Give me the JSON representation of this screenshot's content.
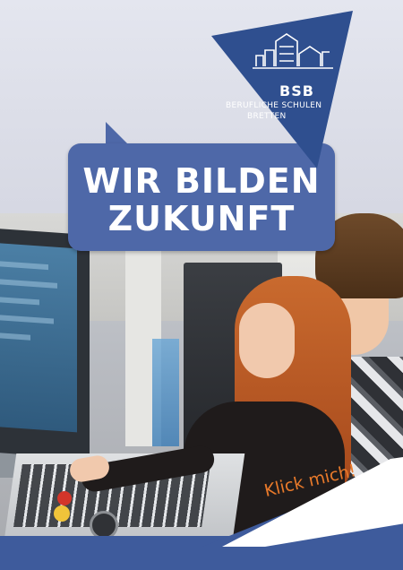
{
  "headline": {
    "line1": "WIR BILDEN",
    "line2": "ZUKUNFT"
  },
  "logo": {
    "abbreviation": "BSB",
    "line1": "BERUFLICHE SCHULEN",
    "line2": "BRETTEN",
    "icon": "school-buildings-icon"
  },
  "cta": {
    "label": "Klick mich!"
  },
  "colors": {
    "brand_blue": "#4e68a8",
    "logo_blue": "#2f4f8f",
    "band_blue": "#3e5b9c",
    "cta_orange": "#e8792a"
  }
}
